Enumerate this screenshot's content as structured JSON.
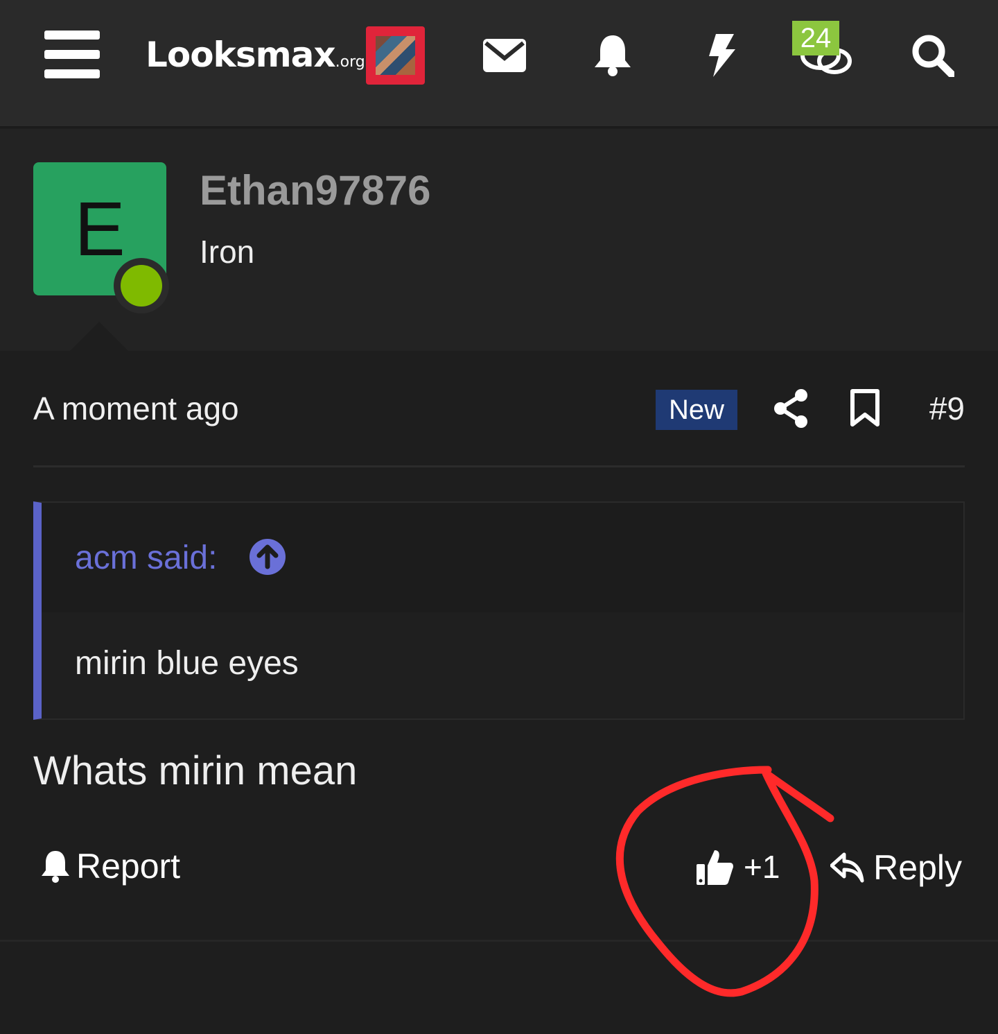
{
  "header": {
    "logo_main": "Looksmax",
    "logo_tld": ".org",
    "conversations_badge": "24",
    "icons": [
      "menu-icon",
      "envelope-icon",
      "bell-icon",
      "lightning-icon",
      "conversations-icon",
      "search-icon"
    ]
  },
  "post": {
    "avatar_letter": "E",
    "username": "Ethan97876",
    "user_title": "Iron",
    "time": "A moment ago",
    "new_label": "New",
    "post_number": "#9",
    "quote": {
      "author": "acm said:",
      "text": "mirin blue eyes"
    },
    "body": "Whats mirin mean",
    "actions": {
      "report_label": "Report",
      "reaction_label": "+1",
      "reply_label": "Reply"
    }
  },
  "colors": {
    "avatar_bg": "#27a15f",
    "online": "#7fba00",
    "badge": "#8cc63f",
    "new_badge": "#1f3a74",
    "quote_accent": "#5b63c8",
    "annotation": "#ff2a2a"
  }
}
